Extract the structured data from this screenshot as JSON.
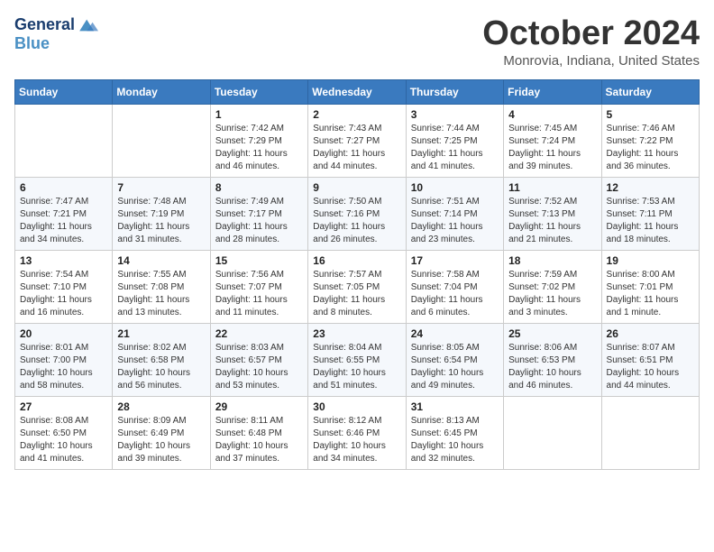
{
  "header": {
    "logo_line1": "General",
    "logo_line2": "Blue",
    "month_title": "October 2024",
    "subtitle": "Monrovia, Indiana, United States"
  },
  "columns": [
    "Sunday",
    "Monday",
    "Tuesday",
    "Wednesday",
    "Thursday",
    "Friday",
    "Saturday"
  ],
  "weeks": [
    [
      {
        "day": "",
        "info": ""
      },
      {
        "day": "",
        "info": ""
      },
      {
        "day": "1",
        "info": "Sunrise: 7:42 AM\nSunset: 7:29 PM\nDaylight: 11 hours and 46 minutes."
      },
      {
        "day": "2",
        "info": "Sunrise: 7:43 AM\nSunset: 7:27 PM\nDaylight: 11 hours and 44 minutes."
      },
      {
        "day": "3",
        "info": "Sunrise: 7:44 AM\nSunset: 7:25 PM\nDaylight: 11 hours and 41 minutes."
      },
      {
        "day": "4",
        "info": "Sunrise: 7:45 AM\nSunset: 7:24 PM\nDaylight: 11 hours and 39 minutes."
      },
      {
        "day": "5",
        "info": "Sunrise: 7:46 AM\nSunset: 7:22 PM\nDaylight: 11 hours and 36 minutes."
      }
    ],
    [
      {
        "day": "6",
        "info": "Sunrise: 7:47 AM\nSunset: 7:21 PM\nDaylight: 11 hours and 34 minutes."
      },
      {
        "day": "7",
        "info": "Sunrise: 7:48 AM\nSunset: 7:19 PM\nDaylight: 11 hours and 31 minutes."
      },
      {
        "day": "8",
        "info": "Sunrise: 7:49 AM\nSunset: 7:17 PM\nDaylight: 11 hours and 28 minutes."
      },
      {
        "day": "9",
        "info": "Sunrise: 7:50 AM\nSunset: 7:16 PM\nDaylight: 11 hours and 26 minutes."
      },
      {
        "day": "10",
        "info": "Sunrise: 7:51 AM\nSunset: 7:14 PM\nDaylight: 11 hours and 23 minutes."
      },
      {
        "day": "11",
        "info": "Sunrise: 7:52 AM\nSunset: 7:13 PM\nDaylight: 11 hours and 21 minutes."
      },
      {
        "day": "12",
        "info": "Sunrise: 7:53 AM\nSunset: 7:11 PM\nDaylight: 11 hours and 18 minutes."
      }
    ],
    [
      {
        "day": "13",
        "info": "Sunrise: 7:54 AM\nSunset: 7:10 PM\nDaylight: 11 hours and 16 minutes."
      },
      {
        "day": "14",
        "info": "Sunrise: 7:55 AM\nSunset: 7:08 PM\nDaylight: 11 hours and 13 minutes."
      },
      {
        "day": "15",
        "info": "Sunrise: 7:56 AM\nSunset: 7:07 PM\nDaylight: 11 hours and 11 minutes."
      },
      {
        "day": "16",
        "info": "Sunrise: 7:57 AM\nSunset: 7:05 PM\nDaylight: 11 hours and 8 minutes."
      },
      {
        "day": "17",
        "info": "Sunrise: 7:58 AM\nSunset: 7:04 PM\nDaylight: 11 hours and 6 minutes."
      },
      {
        "day": "18",
        "info": "Sunrise: 7:59 AM\nSunset: 7:02 PM\nDaylight: 11 hours and 3 minutes."
      },
      {
        "day": "19",
        "info": "Sunrise: 8:00 AM\nSunset: 7:01 PM\nDaylight: 11 hours and 1 minute."
      }
    ],
    [
      {
        "day": "20",
        "info": "Sunrise: 8:01 AM\nSunset: 7:00 PM\nDaylight: 10 hours and 58 minutes."
      },
      {
        "day": "21",
        "info": "Sunrise: 8:02 AM\nSunset: 6:58 PM\nDaylight: 10 hours and 56 minutes."
      },
      {
        "day": "22",
        "info": "Sunrise: 8:03 AM\nSunset: 6:57 PM\nDaylight: 10 hours and 53 minutes."
      },
      {
        "day": "23",
        "info": "Sunrise: 8:04 AM\nSunset: 6:55 PM\nDaylight: 10 hours and 51 minutes."
      },
      {
        "day": "24",
        "info": "Sunrise: 8:05 AM\nSunset: 6:54 PM\nDaylight: 10 hours and 49 minutes."
      },
      {
        "day": "25",
        "info": "Sunrise: 8:06 AM\nSunset: 6:53 PM\nDaylight: 10 hours and 46 minutes."
      },
      {
        "day": "26",
        "info": "Sunrise: 8:07 AM\nSunset: 6:51 PM\nDaylight: 10 hours and 44 minutes."
      }
    ],
    [
      {
        "day": "27",
        "info": "Sunrise: 8:08 AM\nSunset: 6:50 PM\nDaylight: 10 hours and 41 minutes."
      },
      {
        "day": "28",
        "info": "Sunrise: 8:09 AM\nSunset: 6:49 PM\nDaylight: 10 hours and 39 minutes."
      },
      {
        "day": "29",
        "info": "Sunrise: 8:11 AM\nSunset: 6:48 PM\nDaylight: 10 hours and 37 minutes."
      },
      {
        "day": "30",
        "info": "Sunrise: 8:12 AM\nSunset: 6:46 PM\nDaylight: 10 hours and 34 minutes."
      },
      {
        "day": "31",
        "info": "Sunrise: 8:13 AM\nSunset: 6:45 PM\nDaylight: 10 hours and 32 minutes."
      },
      {
        "day": "",
        "info": ""
      },
      {
        "day": "",
        "info": ""
      }
    ]
  ]
}
